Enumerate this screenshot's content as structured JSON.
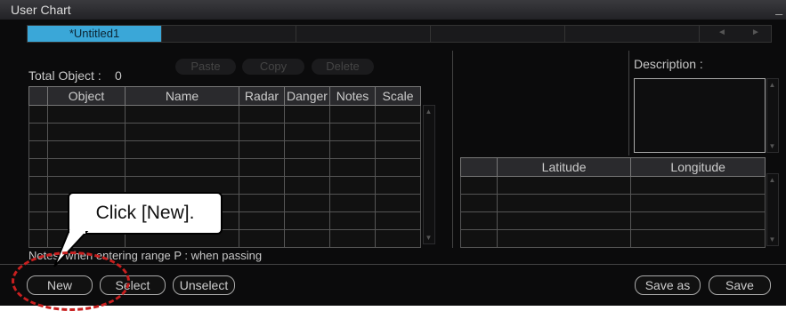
{
  "window": {
    "title": "User Chart",
    "minimize_glyph": "_"
  },
  "tabs": [
    {
      "label": "*Untitled1",
      "active": true
    }
  ],
  "total_object": {
    "label": "Total Object :",
    "value": "0"
  },
  "toolbar": {
    "paste": "Paste",
    "copy": "Copy",
    "delete": "Delete"
  },
  "object_table": {
    "columns": [
      "",
      "Object",
      "Name",
      "Radar",
      "Danger",
      "Notes",
      "Scale"
    ]
  },
  "notes_legend": "Notes: when entering range P : when passing",
  "description_label": "Description :",
  "coord_table": {
    "columns": [
      "",
      "Latitude",
      "Longitude"
    ]
  },
  "buttons": {
    "new": "New",
    "select": "Select",
    "unselect": "Unselect",
    "save_as": "Save as",
    "save": "Save"
  },
  "callout": {
    "text": "Click [New]."
  },
  "colors": {
    "tab_active": "#3aa7d8",
    "highlight": "#c81f1f"
  },
  "icons": [
    "scroll-up-icon",
    "scroll-down-icon",
    "tab-prev-icon",
    "tab-next-icon",
    "minimize-icon"
  ]
}
